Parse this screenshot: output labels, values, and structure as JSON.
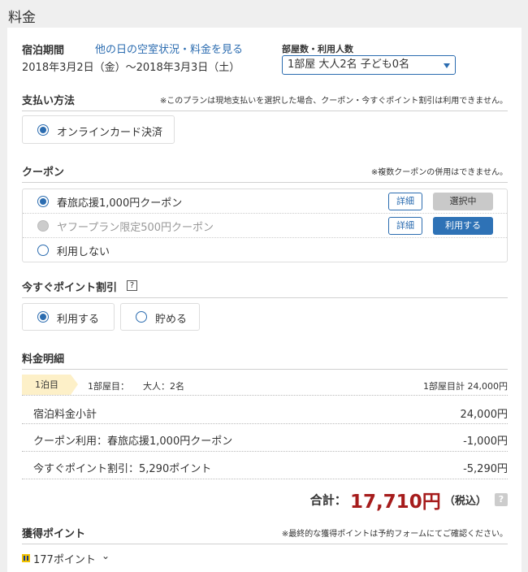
{
  "page_title": "料金",
  "stay": {
    "label": "宿泊期間",
    "link": "他の日の空室状況・料金を見る",
    "dates": "2018年3月2日（金）〜2018年3月3日（土）",
    "rooms_label": "部屋数・利用人数",
    "rooms_value": "1部屋 大人2名 子ども0名"
  },
  "payment": {
    "title": "支払い方法",
    "note": "※このプランは現地支払いを選択した場合、クーポン・今すぐポイント割引は利用できません。",
    "option": "オンラインカード決済"
  },
  "coupon": {
    "title": "クーポン",
    "note": "※複数クーポンの併用はできません。",
    "items": [
      {
        "label": "春旅応援1,000円クーポン",
        "detail": "詳細",
        "action": "選択中"
      },
      {
        "label": "ヤフープラン限定500円クーポン",
        "detail": "詳細",
        "action": "利用する"
      },
      {
        "label": "利用しない"
      }
    ]
  },
  "points": {
    "title": "今すぐポイント割引",
    "help": "?",
    "use": "利用する",
    "save": "貯める"
  },
  "breakdown": {
    "title": "料金明細",
    "night": "1泊目",
    "room": "1部屋目：",
    "guests": "大人：2名",
    "room_total": "1部屋目計 24,000円",
    "rows": [
      {
        "label": "宿泊料金小計",
        "value": "24,000円"
      },
      {
        "label": "クーポン利用：春旅応援1,000円クーポン",
        "value": "-1,000円"
      },
      {
        "label": "今すぐポイント割引：5,290ポイント",
        "value": "-5,290円"
      }
    ],
    "total_label": "合計：",
    "total_value": "17,710円",
    "tax": "（税込）",
    "help": "?"
  },
  "earned": {
    "title": "獲得ポイント",
    "note": "※最終的な獲得ポイントは予約フォームにてご確認ください。",
    "value": "177ポイント"
  },
  "colors": {
    "accent": "#2b6cb0",
    "total": "#a61c1c",
    "night_tag": "#fdf0c8"
  }
}
